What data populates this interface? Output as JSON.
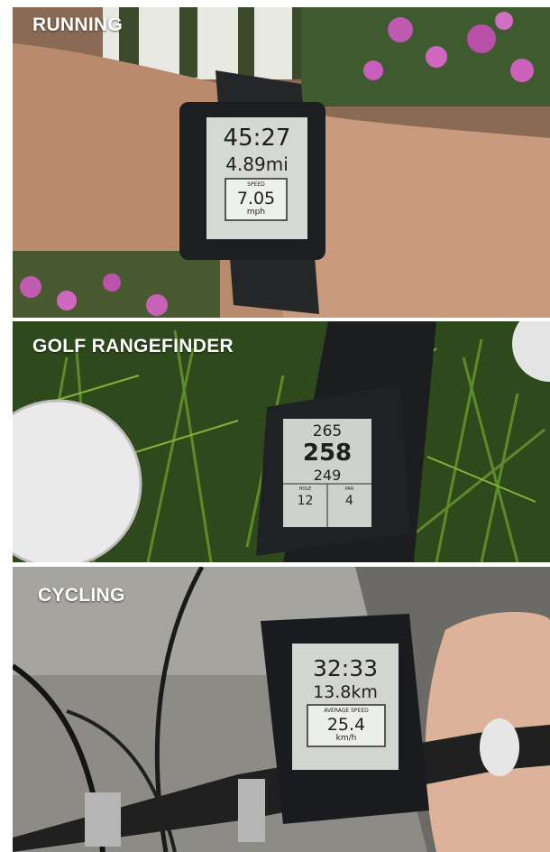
{
  "panels": [
    {
      "title": "RUNNING",
      "watch": {
        "time": "45:27",
        "distance": "4.89mi",
        "box_label": "SPEED",
        "box_value": "7.05",
        "box_unit": "mph"
      }
    },
    {
      "title": "GOLF RANGEFINDER",
      "watch": {
        "back": "265",
        "middle": "258",
        "front": "249",
        "hole_label": "HOLE",
        "hole": "12",
        "par_label": "PAR",
        "par": "4"
      }
    },
    {
      "title": "CYCLING",
      "watch": {
        "time": "32:33",
        "distance": "13.8km",
        "box_label": "AVERAGE SPEED",
        "box_value": "25.4",
        "box_unit": "km/h"
      }
    }
  ]
}
